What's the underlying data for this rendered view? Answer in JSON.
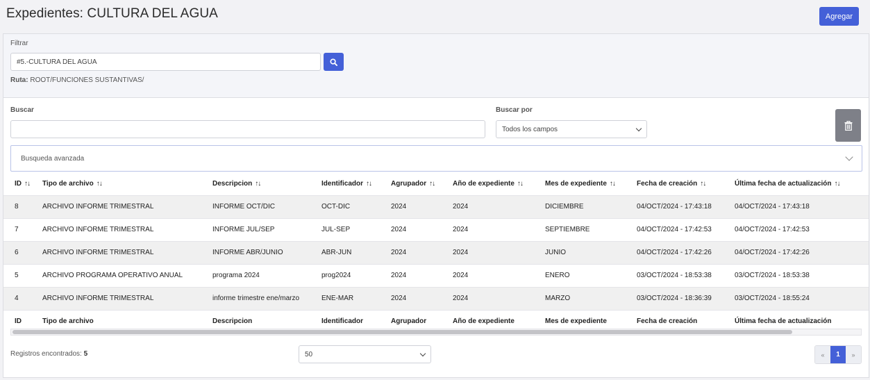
{
  "header": {
    "title": "Expedientes: CULTURA DEL AGUA",
    "add_label": "Agregar"
  },
  "filter": {
    "label": "Filtrar",
    "value": "#5.-CULTURA DEL AGUA",
    "route_label": "Ruta:",
    "route_value": "ROOT/FUNCIONES SUSTANTIVAS/"
  },
  "search": {
    "label": "Buscar",
    "value": "",
    "by_label": "Buscar por",
    "by_selected": "Todos los campos"
  },
  "advanced": {
    "label": "Busqueda avanzada"
  },
  "table": {
    "sort_glyph": "↑↓",
    "columns": [
      "ID",
      "Tipo de archivo",
      "Descripcion",
      "Identificador",
      "Agrupador",
      "Año de expediente",
      "Mes de expediente",
      "Fecha de creación",
      "Última fecha de actualización"
    ],
    "rows": [
      [
        "8",
        "ARCHIVO INFORME TRIMESTRAL",
        "INFORME OCT/DIC",
        "OCT-DIC",
        "2024",
        "2024",
        "DICIEMBRE",
        "04/OCT/2024 - 17:43:18",
        "04/OCT/2024 - 17:43:18"
      ],
      [
        "7",
        "ARCHIVO INFORME TRIMESTRAL",
        "INFORME JUL/SEP",
        "JUL-SEP",
        "2024",
        "2024",
        "SEPTIEMBRE",
        "04/OCT/2024 - 17:42:53",
        "04/OCT/2024 - 17:42:53"
      ],
      [
        "6",
        "ARCHIVO INFORME TRIMESTRAL",
        "INFORME ABR/JUNIO",
        "ABR-JUN",
        "2024",
        "2024",
        "JUNIO",
        "04/OCT/2024 - 17:42:26",
        "04/OCT/2024 - 17:42:26"
      ],
      [
        "5",
        "ARCHIVO PROGRAMA OPERATIVO ANUAL",
        "programa 2024",
        "prog2024",
        "2024",
        "2024",
        "ENERO",
        "03/OCT/2024 - 18:53:38",
        "03/OCT/2024 - 18:53:38"
      ],
      [
        "4",
        "ARCHIVO INFORME TRIMESTRAL",
        "informe trimestre ene/marzo",
        "ENE-MAR",
        "2024",
        "2024",
        "MARZO",
        "03/OCT/2024 - 18:36:39",
        "03/OCT/2024 - 18:55:24"
      ]
    ]
  },
  "footer": {
    "records_label": "Registros encontrados:",
    "records_count": "5",
    "page_size": "50",
    "prev": "«",
    "current_page": "1",
    "next": "»"
  },
  "colors": {
    "primary": "#4460d8",
    "trash": "#7e8088",
    "row_alt": "#f0f0f0"
  }
}
